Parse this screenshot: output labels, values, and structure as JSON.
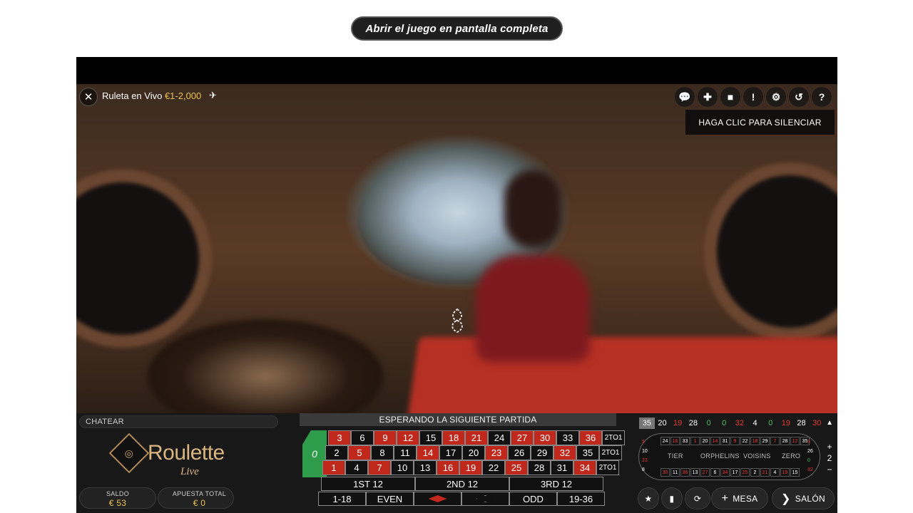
{
  "fullscreen_button": "Abrir el juego en pantalla completa",
  "topbar": {
    "title": "Ruleta en Vivo",
    "limits": "€1-2,000"
  },
  "tooltip": "HAGA CLIC PARA SILENCIAR",
  "chat": {
    "placeholder": "CHATEAR"
  },
  "logo": {
    "name": "Roulette",
    "sub": "Live"
  },
  "balance": {
    "label": "SALDO",
    "value": "€ 53"
  },
  "total_bet": {
    "label": "APUESTA TOTAL",
    "value": "€ 0"
  },
  "status": "ESPERANDO LA SIGUIENTE PARTIDA",
  "betting_table": {
    "zero": "0",
    "rows": [
      [
        {
          "n": "3",
          "c": "red"
        },
        {
          "n": "6",
          "c": "black"
        },
        {
          "n": "9",
          "c": "red"
        },
        {
          "n": "12",
          "c": "red"
        },
        {
          "n": "15",
          "c": "black"
        },
        {
          "n": "18",
          "c": "red"
        },
        {
          "n": "21",
          "c": "red"
        },
        {
          "n": "24",
          "c": "black"
        },
        {
          "n": "27",
          "c": "red"
        },
        {
          "n": "30",
          "c": "red"
        },
        {
          "n": "33",
          "c": "black"
        },
        {
          "n": "36",
          "c": "red"
        }
      ],
      [
        {
          "n": "2",
          "c": "black"
        },
        {
          "n": "5",
          "c": "red"
        },
        {
          "n": "8",
          "c": "black"
        },
        {
          "n": "11",
          "c": "black"
        },
        {
          "n": "14",
          "c": "red"
        },
        {
          "n": "17",
          "c": "black"
        },
        {
          "n": "20",
          "c": "black"
        },
        {
          "n": "23",
          "c": "red"
        },
        {
          "n": "26",
          "c": "black"
        },
        {
          "n": "29",
          "c": "black"
        },
        {
          "n": "32",
          "c": "red"
        },
        {
          "n": "35",
          "c": "black"
        }
      ],
      [
        {
          "n": "1",
          "c": "red"
        },
        {
          "n": "4",
          "c": "black"
        },
        {
          "n": "7",
          "c": "red"
        },
        {
          "n": "10",
          "c": "black"
        },
        {
          "n": "13",
          "c": "black"
        },
        {
          "n": "16",
          "c": "red"
        },
        {
          "n": "19",
          "c": "red"
        },
        {
          "n": "22",
          "c": "black"
        },
        {
          "n": "25",
          "c": "red"
        },
        {
          "n": "28",
          "c": "black"
        },
        {
          "n": "31",
          "c": "black"
        },
        {
          "n": "34",
          "c": "red"
        }
      ]
    ],
    "column_label": "2TO1",
    "dozens": [
      "1ST 12",
      "2ND 12",
      "3RD 12"
    ],
    "outside": [
      "1-18",
      "EVEN",
      "",
      "",
      "ODD",
      "19-36"
    ]
  },
  "history": [
    "35",
    "20",
    "19",
    "28",
    "0",
    "0",
    "32",
    "4",
    "0",
    "19",
    "28",
    "30"
  ],
  "history_colors": [
    "#ffffff",
    "#ffffff",
    "#e33b2e",
    "#ffffff",
    "#3fbf5a",
    "#3fbf5a",
    "#e33b2e",
    "#ffffff",
    "#3fbf5a",
    "#e33b2e",
    "#ffffff",
    "#e33b2e"
  ],
  "racetrack": {
    "labels": [
      "TIER",
      "ORPHELINS",
      "VOISINS",
      "ZERO"
    ],
    "top_row": [
      "24",
      "16",
      "33",
      "1",
      "20",
      "14",
      "31",
      "9",
      "22",
      "18",
      "29",
      "7",
      "28",
      "12",
      "35"
    ],
    "bottom_row": [
      "30",
      "11",
      "36",
      "13",
      "27",
      "6",
      "34",
      "17",
      "25",
      "2",
      "21",
      "4",
      "19",
      "15"
    ],
    "left_nums": [
      "5",
      "10",
      "23",
      "8"
    ],
    "right_nums": [
      "3",
      "26",
      "0",
      "32"
    ]
  },
  "zoom": {
    "plus": "+",
    "value": "2",
    "minus": "−"
  },
  "actions": {
    "favorites_icon": "star-icon",
    "stats_icon": "bar-chart-icon",
    "repeat_icon": "repeat-icon",
    "table_label": "MESA",
    "lobby_label": "SALÓN"
  },
  "colors": {
    "red": "#c0281c",
    "green": "#2e9c4a",
    "gold": "#e8c24a"
  }
}
